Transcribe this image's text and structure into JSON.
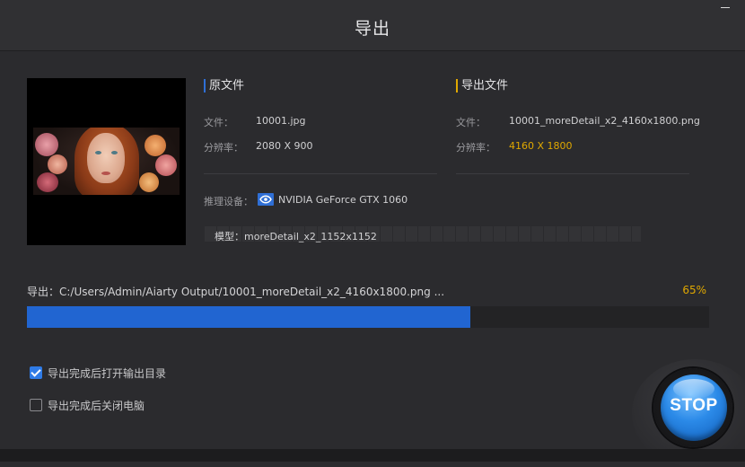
{
  "window": {
    "title": "导出"
  },
  "source": {
    "heading": "原文件",
    "file_label": "文件：",
    "file_value": "10001.jpg",
    "resolution_label": "分辨率：",
    "resolution_value": "2080 X 900"
  },
  "output": {
    "heading": "导出文件",
    "file_label": "文件：",
    "file_value": "10001_moreDetail_x2_4160x1800.png",
    "resolution_label": "分辨率：",
    "resolution_value": "4160 X 1800"
  },
  "device": {
    "label": "推理设备：",
    "value": "NVIDIA GeForce GTX 1060",
    "icon": "nvidia-icon"
  },
  "model": {
    "text": "模型：moreDetail_x2_1152x1152"
  },
  "progress": {
    "label": "导出：C:/Users/Admin/Aiarty Output/10001_moreDetail_x2_4160x1800.png ...",
    "percent_text": "65%",
    "percent": 65
  },
  "options": [
    {
      "label": "导出完成后打开输出目录",
      "checked": true
    },
    {
      "label": "导出完成后关闭电脑",
      "checked": false
    }
  ],
  "stop_button": {
    "label": "STOP"
  },
  "colors": {
    "background": "#2b2b2e",
    "accent_blue": "#2165d1",
    "accent_gold": "#e0a800"
  }
}
